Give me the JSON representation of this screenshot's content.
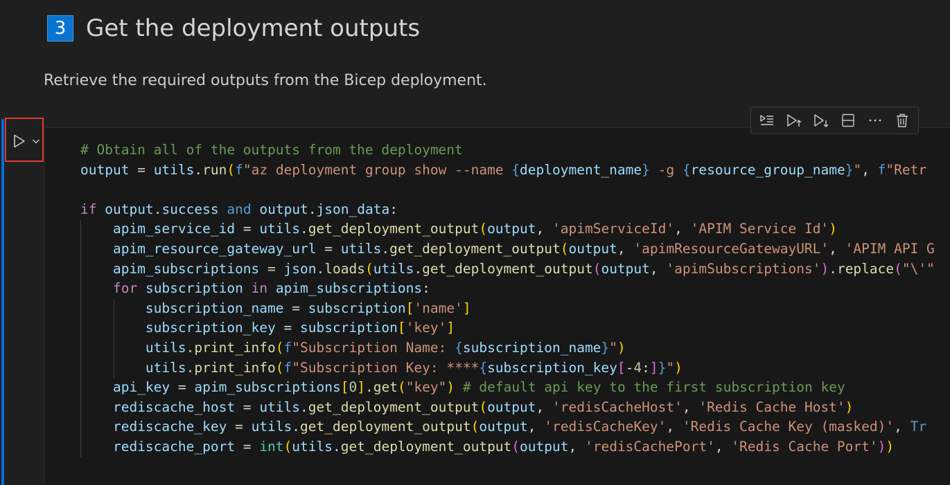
{
  "markdown": {
    "step_number": "3",
    "heading": "Get the deployment outputs",
    "paragraph": "Retrieve the required outputs from the Bicep deployment."
  },
  "cell_toolbar": {
    "buttons": [
      {
        "name": "execute-above-icon"
      },
      {
        "name": "execute-cell-and-above-icon"
      },
      {
        "name": "execute-cell-and-below-icon"
      },
      {
        "name": "split-cell-icon"
      },
      {
        "name": "more-actions-icon"
      },
      {
        "name": "delete-cell-icon"
      }
    ]
  },
  "run_controls": {
    "run_icon": "play-icon",
    "dropdown_icon": "chevron-down-icon"
  },
  "colors": {
    "accent": "#0b6cd3",
    "highlight_border": "#e23b3b",
    "comment": "#6a9955",
    "string": "#ce9178",
    "function": "#dcdcaa",
    "variable": "#9cdcfe",
    "keyword": "#c586c0"
  },
  "code": {
    "lines": [
      [
        [
          "c",
          "# Obtain all of the outputs from the deployment"
        ]
      ],
      [
        [
          "v",
          "output"
        ],
        [
          "p",
          " = "
        ],
        [
          "v",
          "utils"
        ],
        [
          "p",
          "."
        ],
        [
          "f",
          "run"
        ],
        [
          "b1",
          "("
        ],
        [
          "kb",
          "f"
        ],
        [
          "s",
          "\"az deployment group show --name "
        ],
        [
          "kb",
          "{"
        ],
        [
          "v",
          "deployment_name"
        ],
        [
          "kb",
          "}"
        ],
        [
          "s",
          " -g "
        ],
        [
          "kb",
          "{"
        ],
        [
          "v",
          "resource_group_name"
        ],
        [
          "kb",
          "}"
        ],
        [
          "s",
          "\""
        ],
        [
          "p",
          ", "
        ],
        [
          "kb",
          "f"
        ],
        [
          "s",
          "\"Retr"
        ]
      ],
      [],
      [
        [
          "k",
          "if"
        ],
        [
          "p",
          " "
        ],
        [
          "v",
          "output"
        ],
        [
          "p",
          "."
        ],
        [
          "v",
          "success"
        ],
        [
          "p",
          " "
        ],
        [
          "kb",
          "and"
        ],
        [
          "p",
          " "
        ],
        [
          "v",
          "output"
        ],
        [
          "p",
          "."
        ],
        [
          "v",
          "json_data"
        ],
        [
          "p",
          ":"
        ]
      ],
      [
        [
          "p",
          "    "
        ],
        [
          "v",
          "apim_service_id"
        ],
        [
          "p",
          " = "
        ],
        [
          "v",
          "utils"
        ],
        [
          "p",
          "."
        ],
        [
          "f",
          "get_deployment_output"
        ],
        [
          "b1",
          "("
        ],
        [
          "v",
          "output"
        ],
        [
          "p",
          ", "
        ],
        [
          "s",
          "'apimServiceId'"
        ],
        [
          "p",
          ", "
        ],
        [
          "s",
          "'APIM Service Id'"
        ],
        [
          "b1",
          ")"
        ]
      ],
      [
        [
          "p",
          "    "
        ],
        [
          "v",
          "apim_resource_gateway_url"
        ],
        [
          "p",
          " = "
        ],
        [
          "v",
          "utils"
        ],
        [
          "p",
          "."
        ],
        [
          "f",
          "get_deployment_output"
        ],
        [
          "b1",
          "("
        ],
        [
          "v",
          "output"
        ],
        [
          "p",
          ", "
        ],
        [
          "s",
          "'apimResourceGatewayURL'"
        ],
        [
          "p",
          ", "
        ],
        [
          "s",
          "'APIM API G"
        ]
      ],
      [
        [
          "p",
          "    "
        ],
        [
          "v",
          "apim_subscriptions"
        ],
        [
          "p",
          " = "
        ],
        [
          "v",
          "json"
        ],
        [
          "p",
          "."
        ],
        [
          "f",
          "loads"
        ],
        [
          "b1",
          "("
        ],
        [
          "v",
          "utils"
        ],
        [
          "p",
          "."
        ],
        [
          "f",
          "get_deployment_output"
        ],
        [
          "b2",
          "("
        ],
        [
          "v",
          "output"
        ],
        [
          "p",
          ", "
        ],
        [
          "s",
          "'apimSubscriptions'"
        ],
        [
          "b2",
          ")"
        ],
        [
          "p",
          "."
        ],
        [
          "f",
          "replace"
        ],
        [
          "b2",
          "("
        ],
        [
          "s",
          "\"\\'\""
        ]
      ],
      [
        [
          "p",
          "    "
        ],
        [
          "k",
          "for"
        ],
        [
          "p",
          " "
        ],
        [
          "v",
          "subscription"
        ],
        [
          "p",
          " "
        ],
        [
          "k",
          "in"
        ],
        [
          "p",
          " "
        ],
        [
          "v",
          "apim_subscriptions"
        ],
        [
          "p",
          ":"
        ]
      ],
      [
        [
          "p",
          "        "
        ],
        [
          "v",
          "subscription_name"
        ],
        [
          "p",
          " = "
        ],
        [
          "v",
          "subscription"
        ],
        [
          "b1",
          "["
        ],
        [
          "s",
          "'name'"
        ],
        [
          "b1",
          "]"
        ]
      ],
      [
        [
          "p",
          "        "
        ],
        [
          "v",
          "subscription_key"
        ],
        [
          "p",
          " = "
        ],
        [
          "v",
          "subscription"
        ],
        [
          "b1",
          "["
        ],
        [
          "s",
          "'key'"
        ],
        [
          "b1",
          "]"
        ]
      ],
      [
        [
          "p",
          "        "
        ],
        [
          "v",
          "utils"
        ],
        [
          "p",
          "."
        ],
        [
          "f",
          "print_info"
        ],
        [
          "b1",
          "("
        ],
        [
          "kb",
          "f"
        ],
        [
          "s",
          "\"Subscription Name: "
        ],
        [
          "kb",
          "{"
        ],
        [
          "v",
          "subscription_name"
        ],
        [
          "kb",
          "}"
        ],
        [
          "s",
          "\""
        ],
        [
          "b1",
          ")"
        ]
      ],
      [
        [
          "p",
          "        "
        ],
        [
          "v",
          "utils"
        ],
        [
          "p",
          "."
        ],
        [
          "f",
          "print_info"
        ],
        [
          "b1",
          "("
        ],
        [
          "kb",
          "f"
        ],
        [
          "s",
          "\"Subscription Key: ****"
        ],
        [
          "kb",
          "{"
        ],
        [
          "v",
          "subscription_key"
        ],
        [
          "b2",
          "["
        ],
        [
          "p",
          "-"
        ],
        [
          "n",
          "4"
        ],
        [
          "p",
          ":"
        ],
        [
          "b2",
          "]"
        ],
        [
          "kb",
          "}"
        ],
        [
          "s",
          "\""
        ],
        [
          "b1",
          ")"
        ]
      ],
      [
        [
          "p",
          "    "
        ],
        [
          "v",
          "api_key"
        ],
        [
          "p",
          " = "
        ],
        [
          "v",
          "apim_subscriptions"
        ],
        [
          "b1",
          "["
        ],
        [
          "n",
          "0"
        ],
        [
          "b1",
          "]"
        ],
        [
          "p",
          "."
        ],
        [
          "f",
          "get"
        ],
        [
          "b1",
          "("
        ],
        [
          "s",
          "\"key\""
        ],
        [
          "b1",
          ")"
        ],
        [
          "p",
          " "
        ],
        [
          "c",
          "# default api key to the first subscription key"
        ]
      ],
      [
        [
          "p",
          "    "
        ],
        [
          "v",
          "rediscache_host"
        ],
        [
          "p",
          " = "
        ],
        [
          "v",
          "utils"
        ],
        [
          "p",
          "."
        ],
        [
          "f",
          "get_deployment_output"
        ],
        [
          "b1",
          "("
        ],
        [
          "v",
          "output"
        ],
        [
          "p",
          ", "
        ],
        [
          "s",
          "'redisCacheHost'"
        ],
        [
          "p",
          ", "
        ],
        [
          "s",
          "'Redis Cache Host'"
        ],
        [
          "b1",
          ")"
        ]
      ],
      [
        [
          "p",
          "    "
        ],
        [
          "v",
          "rediscache_key"
        ],
        [
          "p",
          " = "
        ],
        [
          "v",
          "utils"
        ],
        [
          "p",
          "."
        ],
        [
          "f",
          "get_deployment_output"
        ],
        [
          "b1",
          "("
        ],
        [
          "v",
          "output"
        ],
        [
          "p",
          ", "
        ],
        [
          "s",
          "'redisCacheKey'"
        ],
        [
          "p",
          ", "
        ],
        [
          "s",
          "'Redis Cache Key (masked)'"
        ],
        [
          "p",
          ", "
        ],
        [
          "kb",
          "Tr"
        ]
      ],
      [
        [
          "p",
          "    "
        ],
        [
          "v",
          "rediscache_port"
        ],
        [
          "p",
          " = "
        ],
        [
          "t",
          "int"
        ],
        [
          "b1",
          "("
        ],
        [
          "v",
          "utils"
        ],
        [
          "p",
          "."
        ],
        [
          "f",
          "get_deployment_output"
        ],
        [
          "b2",
          "("
        ],
        [
          "v",
          "output"
        ],
        [
          "p",
          ", "
        ],
        [
          "s",
          "'redisCachePort'"
        ],
        [
          "p",
          ", "
        ],
        [
          "s",
          "'Redis Cache Port'"
        ],
        [
          "b2",
          ")"
        ],
        [
          "b1",
          ")"
        ]
      ]
    ]
  }
}
